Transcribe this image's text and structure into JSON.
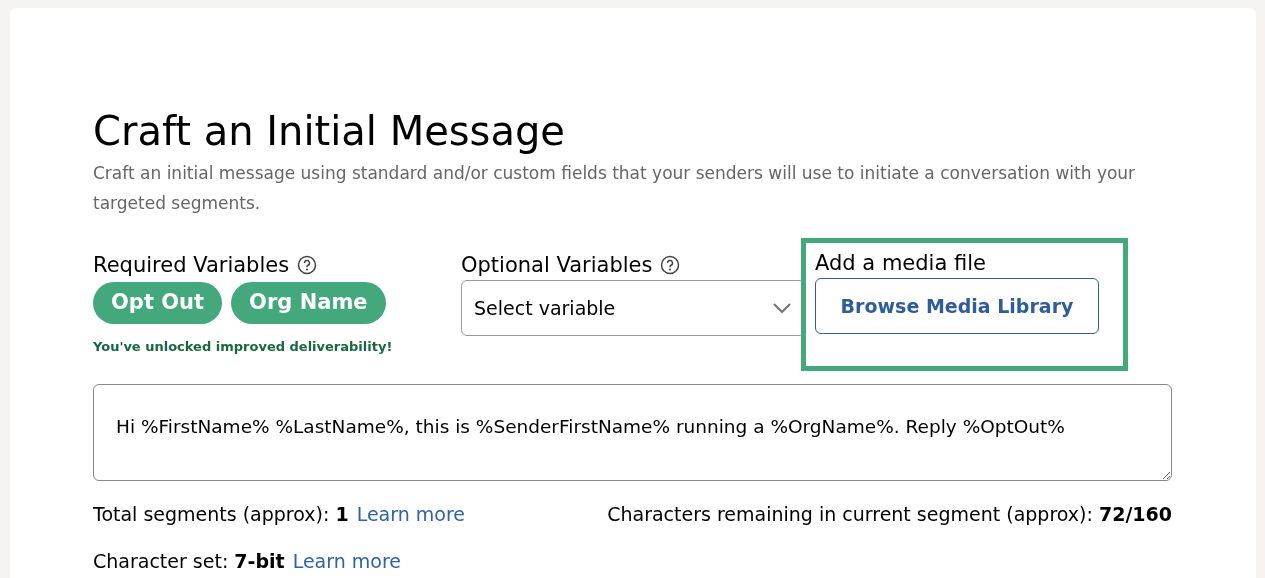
{
  "title": "Craft an Initial Message",
  "description": "Craft an initial message using standard and/or custom fields that your senders will use to initiate a conversation with your targeted segments.",
  "required_variables": {
    "label": "Required Variables",
    "chips": [
      "Opt Out",
      "Org Name"
    ],
    "note": "You've unlocked improved deliverability!"
  },
  "optional_variables": {
    "label": "Optional Variables",
    "placeholder": "Select variable"
  },
  "media": {
    "label": "Add a media file",
    "button": "Browse Media Library",
    "highlighted": true
  },
  "message": {
    "value": "Hi %FirstName% %LastName%, this is %SenderFirstName% running a %OrgName%. Reply %OptOut%"
  },
  "stats": [
    {
      "text": "Total segments (approx): **1**",
      "link": "Learn more"
    },
    {
      "text": "Characters remaining in current segment (approx): **72/160**"
    },
    {
      "text": "Character set: **7-bit**",
      "link": "Learn more"
    }
  ]
}
